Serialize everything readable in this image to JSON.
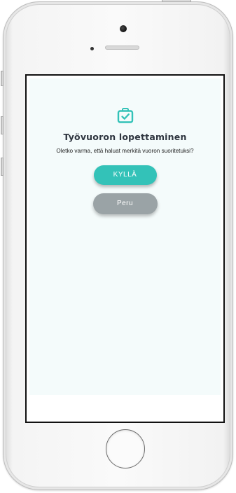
{
  "dialog": {
    "icon": "briefcase-check-icon",
    "title": "Työvuoron lopettaminen",
    "message": "Oletko varma, että haluat merkitä vuoron suoritetuksi?",
    "confirm_label": "KYLLÄ",
    "cancel_label": "Peru"
  },
  "colors": {
    "accent": "#33c2b8",
    "cancel": "#9aa3a6",
    "title": "#2f3640",
    "background": "#f4fbfb"
  }
}
